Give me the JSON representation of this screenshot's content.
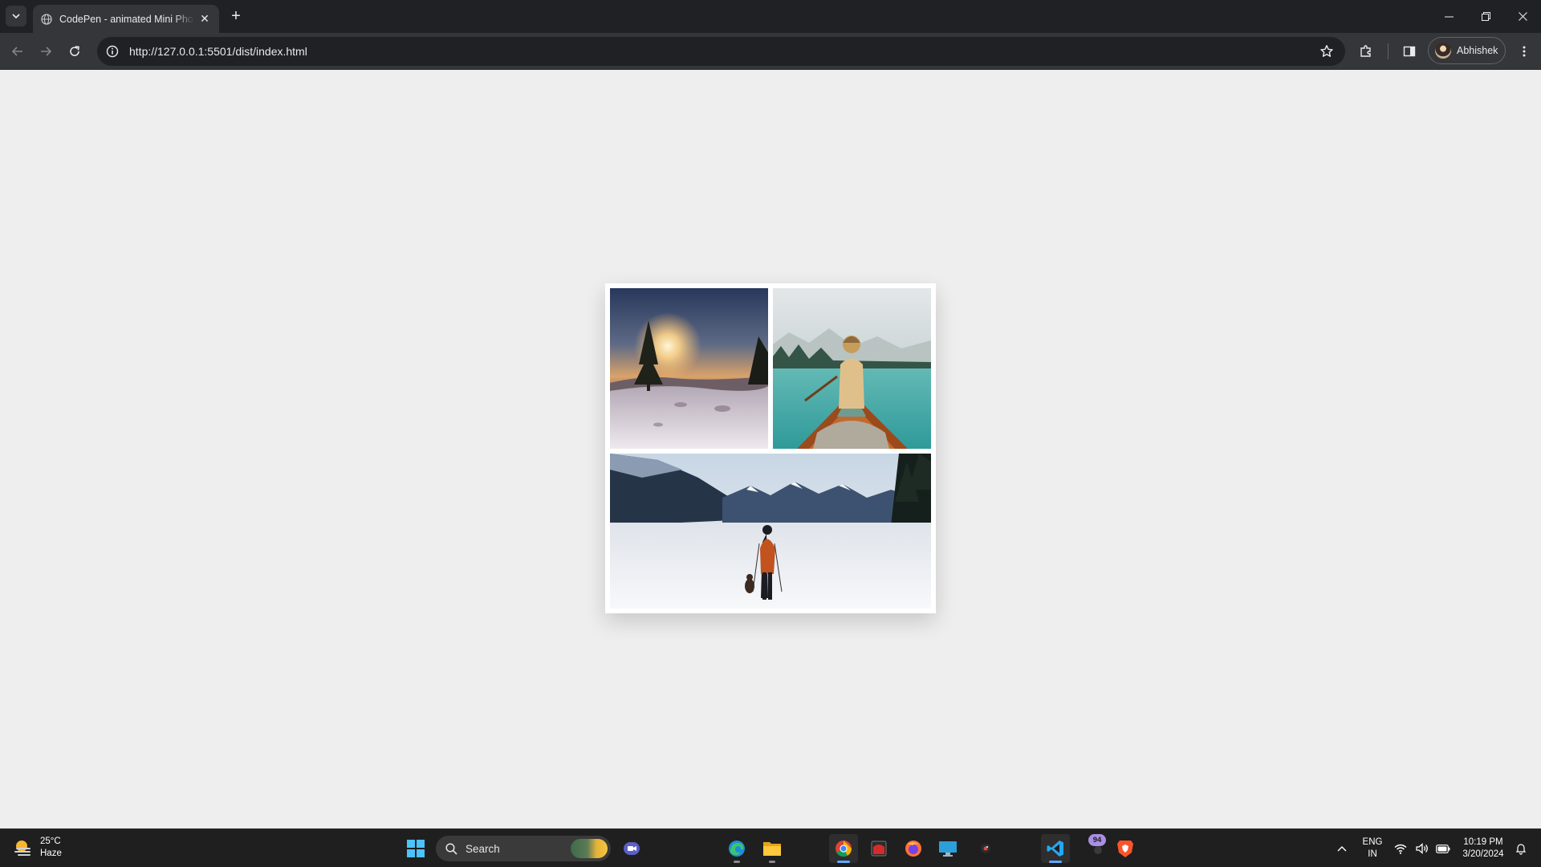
{
  "browser": {
    "tab_title": "CodePen - animated Mini Photo Gallery",
    "url": "http://127.0.0.1:5501/dist/index.html",
    "profile_name": "Abhishek"
  },
  "gallery": {
    "photos": [
      {
        "name": "winter sunset with snowy trees"
      },
      {
        "name": "woman in canoe on turquoise lake"
      },
      {
        "name": "hiker with dog on snowy field below mountains"
      }
    ]
  },
  "taskbar": {
    "weather_temp": "25°C",
    "weather_desc": "Haze",
    "search_label": "Search",
    "notification_badge": "94",
    "lang_primary": "ENG",
    "lang_secondary": "IN",
    "time": "10:19 PM",
    "date": "3/20/2024"
  },
  "colors": {
    "page_bg": "#eeeeee",
    "browser_dark": "#202124",
    "toolbar": "#35363a",
    "taskbar": "#1f1f1f",
    "accent": "#62a8ff"
  }
}
